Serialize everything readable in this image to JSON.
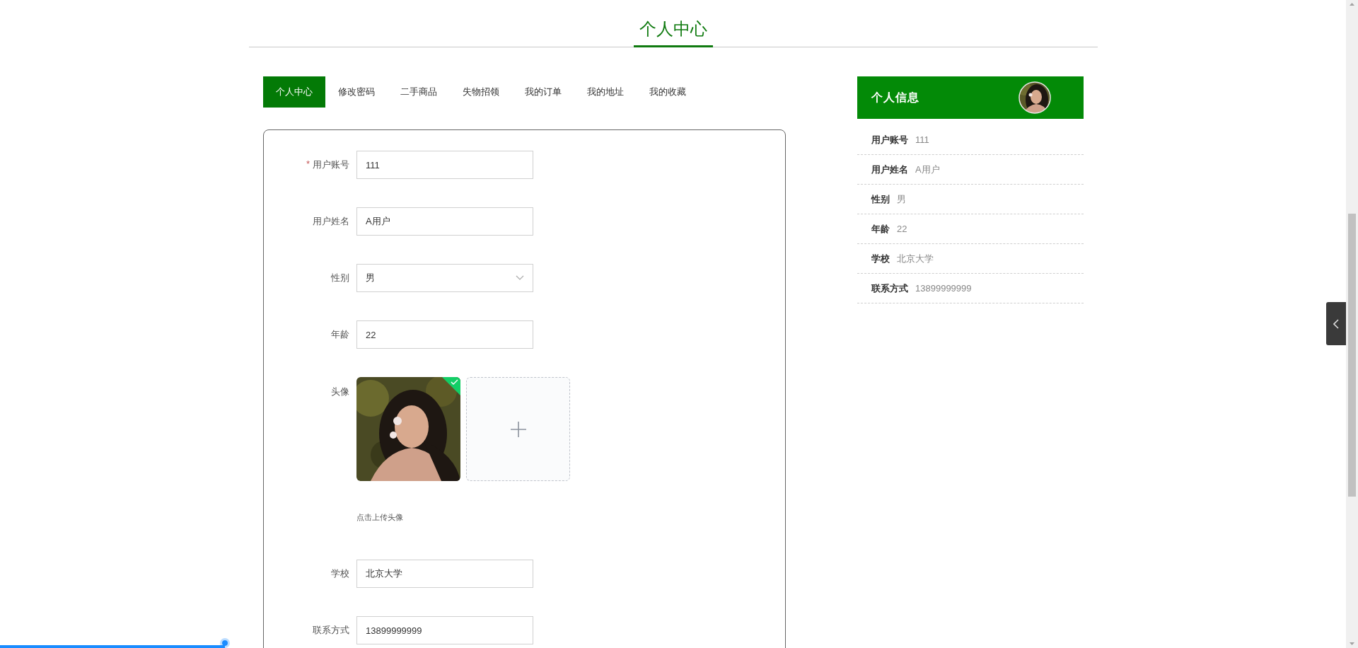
{
  "page_title": "个人中心",
  "tabs": [
    {
      "label": "个人中心",
      "selected": true
    },
    {
      "label": "修改密码",
      "selected": false
    },
    {
      "label": "二手商品",
      "selected": false
    },
    {
      "label": "失物招领",
      "selected": false
    },
    {
      "label": "我的订单",
      "selected": false
    },
    {
      "label": "我的地址",
      "selected": false
    },
    {
      "label": "我的收藏",
      "selected": false
    }
  ],
  "form": {
    "fields": [
      {
        "kind": "input",
        "label": "用户账号",
        "required_mark": "*",
        "value": "111"
      },
      {
        "kind": "input",
        "label": "用户姓名",
        "value": "A用户"
      },
      {
        "kind": "select",
        "label": "性别",
        "value": "男"
      },
      {
        "kind": "input",
        "label": "年龄",
        "value": "22"
      },
      {
        "kind": "upload",
        "label": "头像",
        "uploaded": true,
        "hint": "点击上传头像"
      },
      {
        "kind": "input",
        "label": "学校",
        "value": "北京大学"
      },
      {
        "kind": "input",
        "label": "联系方式",
        "value": "13899999999"
      }
    ]
  },
  "info_panel": {
    "title": "个人信息",
    "rows": [
      {
        "label": "用户账号",
        "value": "111"
      },
      {
        "label": "用户姓名",
        "value": "A用户"
      },
      {
        "label": "性别",
        "value": "男"
      },
      {
        "label": "年龄",
        "value": "22"
      },
      {
        "label": "学校",
        "value": "北京大学"
      },
      {
        "label": "联系方式",
        "value": "13899999999"
      }
    ]
  },
  "playback": {
    "level": 0.167
  }
}
